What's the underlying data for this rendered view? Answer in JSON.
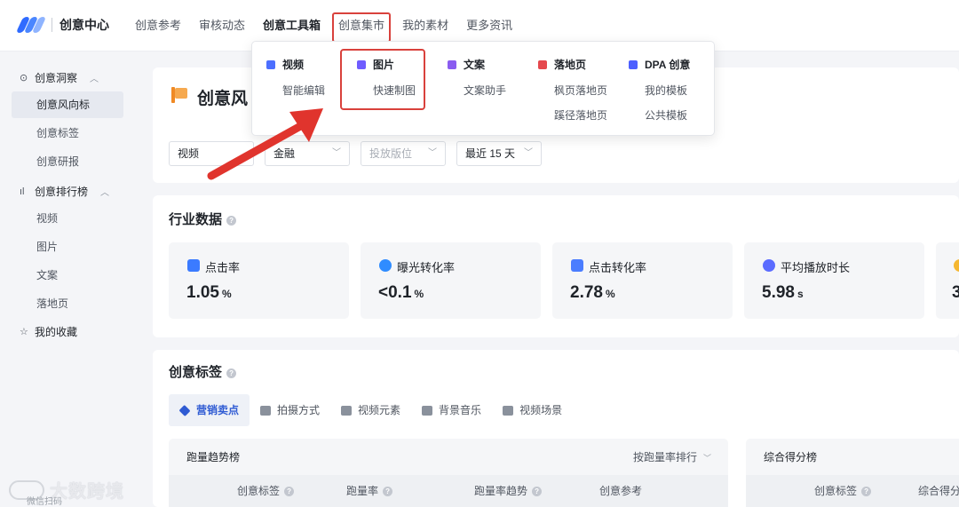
{
  "brand": {
    "title": "创意中心"
  },
  "nav": {
    "items": [
      {
        "label": "创意参考"
      },
      {
        "label": "审核动态"
      },
      {
        "label": "创意工具箱"
      },
      {
        "label": "创意集市"
      },
      {
        "label": "我的素材"
      },
      {
        "label": "更多资讯"
      }
    ]
  },
  "sidebar": {
    "group1": "创意洞察",
    "group1_items": [
      "创意风向标",
      "创意标签",
      "创意研报"
    ],
    "group2": "创意排行榜",
    "group2_items": [
      "视频",
      "图片",
      "文案",
      "落地页"
    ],
    "favorites": "我的收藏"
  },
  "dropdown": {
    "columns": [
      {
        "head": "视频",
        "links": [
          "智能编辑"
        ],
        "color": "#4c6fff"
      },
      {
        "head": "图片",
        "links": [
          "快速制图"
        ],
        "color": "#6f5cff"
      },
      {
        "head": "文案",
        "links": [
          "文案助手"
        ],
        "color": "#8a5cf0"
      },
      {
        "head": "落地页",
        "links": [
          "枫页落地页",
          "蹊径落地页"
        ],
        "color": "#e5484d"
      },
      {
        "head": "DPA 创意",
        "links": [
          "我的模板",
          "公共模板"
        ],
        "color": "#4c5fff"
      }
    ]
  },
  "main": {
    "title": "创意风",
    "filters": {
      "f1": "视频",
      "f2": "金融",
      "f3": "投放版位",
      "f4": "最近 15 天"
    },
    "industry": {
      "title": "行业数据",
      "metrics": [
        {
          "label": "点击率",
          "value": "1.05",
          "unit": "%",
          "color": "#3b7bff"
        },
        {
          "label": "曝光转化率",
          "value": "<0.1",
          "unit": "%",
          "color": "#2f8cff"
        },
        {
          "label": "点击转化率",
          "value": "2.78",
          "unit": "%",
          "color": "#4a7dff"
        },
        {
          "label": "平均播放时长",
          "value": "5.98",
          "unit": "s",
          "color": "#5b6cff"
        },
        {
          "label": "",
          "value": "3",
          "unit": "",
          "color": "#f5b731"
        }
      ]
    },
    "tags": {
      "title": "创意标签",
      "tabs": [
        "营销卖点",
        "拍摄方式",
        "视频元素",
        "背景音乐",
        "视频场景"
      ],
      "left": {
        "title": "跑量趋势榜",
        "sort": "按跑量率排行",
        "columns": [
          "创意标签",
          "跑量率",
          "跑量率趋势",
          "创意参考"
        ]
      },
      "right": {
        "title": "综合得分榜",
        "columns": [
          "创意标签",
          "综合得分"
        ]
      }
    }
  },
  "watermark": {
    "text": "大数跨境",
    "sub": "微信扫码"
  }
}
